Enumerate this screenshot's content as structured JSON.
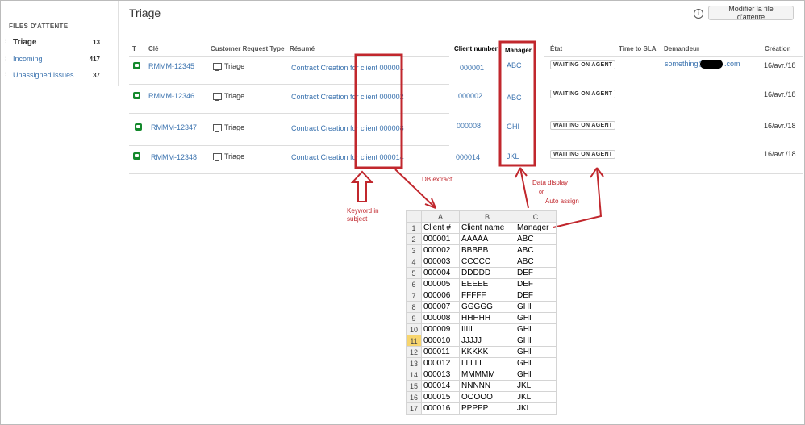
{
  "sidebar": {
    "title": "FILES D'ATTENTE",
    "items": [
      {
        "label": "Triage",
        "count": "13"
      },
      {
        "label": "Incoming",
        "count": "417"
      },
      {
        "label": "Unassigned issues",
        "count": "37"
      }
    ]
  },
  "header": {
    "title": "Triage",
    "edit_button": "Modifier la file d'attente"
  },
  "table": {
    "columns": [
      "T",
      "Clé",
      "Customer Request Type",
      "Résumé",
      "Client number",
      "Manager",
      "État",
      "Time to SLA",
      "Demandeur",
      "Création"
    ],
    "rows": [
      {
        "key": "RMMM-12345",
        "type": "Triage",
        "summary": "Contract Creation for client  000001",
        "client": "000001",
        "manager": "ABC",
        "state": "WAITING ON AGENT",
        "requester": "something@",
        "requester_suffix": ".com",
        "created": "16/avr./18"
      },
      {
        "key": "RMMM-12346",
        "type": "Triage",
        "summary": "Contract Creation for client  000002",
        "client": "000002",
        "manager": "ABC",
        "state": "WAITING ON AGENT",
        "requester": "",
        "requester_suffix": "",
        "created": "16/avr./18"
      },
      {
        "key": "RMMM-12347",
        "type": "Triage",
        "summary": "Contract Creation for client  000008",
        "client": "000008",
        "manager": "GHI",
        "state": "WAITING ON AGENT",
        "requester": "",
        "requester_suffix": "",
        "created": "16/avr./18"
      },
      {
        "key": "RMMM-12348",
        "type": "Triage",
        "summary": "Contract Creation for client  000014",
        "client": "000014",
        "manager": "JKL",
        "state": "WAITING ON AGENT",
        "requester": "",
        "requester_suffix": "",
        "created": "16/avr./18"
      }
    ]
  },
  "annotations": {
    "db_extract": "DB extract",
    "keyword_line1": "Keyword in",
    "keyword_line2": "subject",
    "data_display": "Data display",
    "or": "or",
    "auto_assign": "Auto assign",
    "color": "#c1272d"
  },
  "spreadsheet": {
    "col_letters": [
      "A",
      "B",
      "C"
    ],
    "headers": [
      "Client #",
      "Client name",
      "Manager"
    ],
    "rows": [
      [
        "000001",
        "AAAAA",
        "ABC"
      ],
      [
        "000002",
        "BBBBB",
        "ABC"
      ],
      [
        "000003",
        "CCCCC",
        "ABC"
      ],
      [
        "000004",
        "DDDDD",
        "DEF"
      ],
      [
        "000005",
        "EEEEE",
        "DEF"
      ],
      [
        "000006",
        "FFFFF",
        "DEF"
      ],
      [
        "000007",
        "GGGGG",
        "GHI"
      ],
      [
        "000008",
        "HHHHH",
        "GHI"
      ],
      [
        "000009",
        "IIIII",
        "GHI"
      ],
      [
        "000010",
        "JJJJJ",
        "GHI"
      ],
      [
        "000011",
        "KKKKK",
        "GHI"
      ],
      [
        "000012",
        "LLLLL",
        "GHI"
      ],
      [
        "000013",
        "MMMMM",
        "GHI"
      ],
      [
        "000014",
        "NNNNN",
        "JKL"
      ],
      [
        "000015",
        "OOOOO",
        "JKL"
      ],
      [
        "000016",
        "PPPPP",
        "JKL"
      ]
    ],
    "selected_row": "11"
  }
}
